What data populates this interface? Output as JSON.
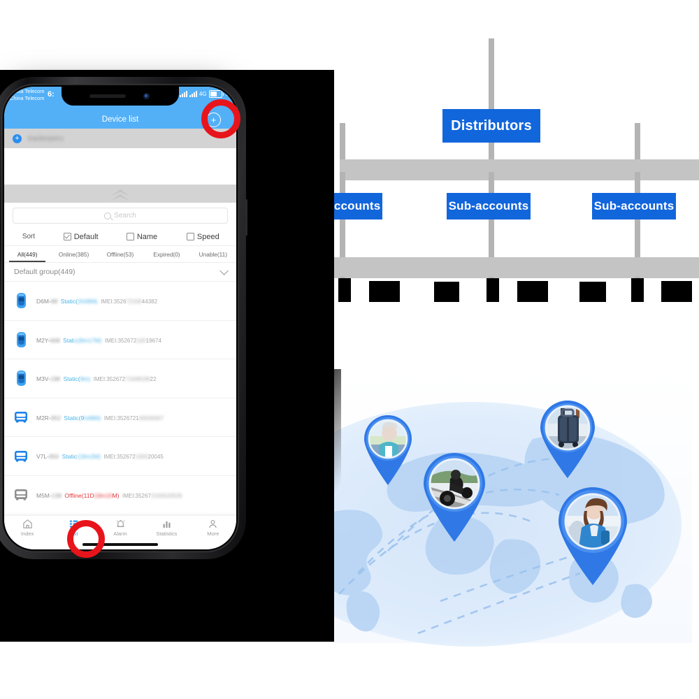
{
  "phone": {
    "status_bar": {
      "carrier_line1": "China Telecom",
      "carrier_line2": "China Telecom",
      "time": "6:",
      "network": "4G",
      "battery": "56"
    },
    "header": {
      "title": "Device list",
      "add_icon": "plus-circle-icon"
    },
    "account_strip": {
      "plus_icon": "plus-circle-icon",
      "account_name": "trackerperu"
    },
    "collapse_icon": "double-chevron-up-icon",
    "search": {
      "placeholder": "Search",
      "icon": "search-icon"
    },
    "sort": {
      "label": "Sort",
      "options": [
        {
          "label": "Default",
          "checked": true
        },
        {
          "label": "Name",
          "checked": false
        },
        {
          "label": "Speed",
          "checked": false
        }
      ]
    },
    "filters": [
      {
        "label": "All(449)",
        "active": true
      },
      {
        "label": "Online(385)",
        "active": false
      },
      {
        "label": "Offline(53)",
        "active": false
      },
      {
        "label": "Expired(0)",
        "active": false
      },
      {
        "label": "Unable(11)",
        "active": false
      }
    ],
    "group": {
      "label": "Default group(449)",
      "chevron": "chevron-down-icon"
    },
    "devices": [
      {
        "icon": "car-icon",
        "name": "D6M-",
        "name_blur": "88",
        "status_prefix": "Static(",
        "status_blur": "2h08M)",
        "status_state": "static",
        "imei_prefix": "IMEI:3526",
        "imei_blur": "72100",
        "imei_suffix": "44382"
      },
      {
        "icon": "car-icon",
        "name": "M2Y-",
        "name_blur": "668",
        "status_prefix": "Stat",
        "status_blur": "ic(8m17M)",
        "status_state": "static",
        "imei_prefix": "IMEI:352672",
        "imei_blur": "100",
        "imei_suffix": "19674"
      },
      {
        "icon": "car-icon",
        "name": "M3V-",
        "name_blur": "198",
        "status_prefix": "Static(",
        "status_blur": "8m)",
        "status_state": "static",
        "imei_prefix": "IMEI:352672",
        "imei_blur": "71008199",
        "imei_suffix": "22"
      },
      {
        "icon": "bus-icon",
        "name": "M2R-",
        "name_blur": "952",
        "status_prefix": "Static(9",
        "status_blur": "h48M)",
        "status_state": "static",
        "imei_prefix": "IMEI:3526721",
        "imei_blur": "00500007",
        "imei_suffix": ""
      },
      {
        "icon": "bus-icon",
        "name": "V7L-",
        "name_blur": "950",
        "status_prefix": "Static",
        "status_blur": "(19m2M)",
        "status_state": "static",
        "imei_prefix": "IMEI:352672",
        "imei_blur": "1005",
        "imei_suffix": "20045"
      },
      {
        "icon": "bus-gray-icon",
        "name": "M5M-",
        "name_blur": "139",
        "status_prefix": "Offline(11D",
        "status_blur": "19m19",
        "status_suffix": "M)",
        "status_state": "offline",
        "imei_prefix": "IMEI:35267",
        "imei_blur": "2100520526",
        "imei_suffix": ""
      }
    ],
    "tabbar": [
      {
        "label": "Index",
        "icon": "home-icon",
        "active": false
      },
      {
        "label": "List",
        "icon": "list-icon",
        "active": true
      },
      {
        "label": "Alarm",
        "icon": "alarm-icon",
        "active": false
      },
      {
        "label": "Statistics",
        "icon": "chart-icon",
        "active": false
      },
      {
        "label": "More",
        "icon": "person-icon",
        "active": false
      }
    ],
    "highlights": [
      {
        "name": "add-device-highlight-ring"
      },
      {
        "name": "list-tab-highlight-ring"
      }
    ]
  },
  "diagram": {
    "root": {
      "label": "Distributors"
    },
    "children": [
      {
        "label": "Sub-accounts"
      },
      {
        "label": "Sub-accounts"
      },
      {
        "label": "Sub-accounts"
      }
    ],
    "colors": {
      "node_blue": "#1266dc",
      "connector_gray": "#b4b4b4",
      "bar_gray": "#c4c4c4",
      "highlight_red": "#e8141b",
      "app_blue": "#53b0f7",
      "pin_blue": "#3c86ef"
    }
  },
  "map": {
    "pins": [
      {
        "name": "pin-child-backpack"
      },
      {
        "name": "pin-elderly-person"
      },
      {
        "name": "pin-motorcycle-rider"
      },
      {
        "name": "pin-luggage-suitcase"
      },
      {
        "name": "pin-woman-traveler"
      }
    ]
  }
}
